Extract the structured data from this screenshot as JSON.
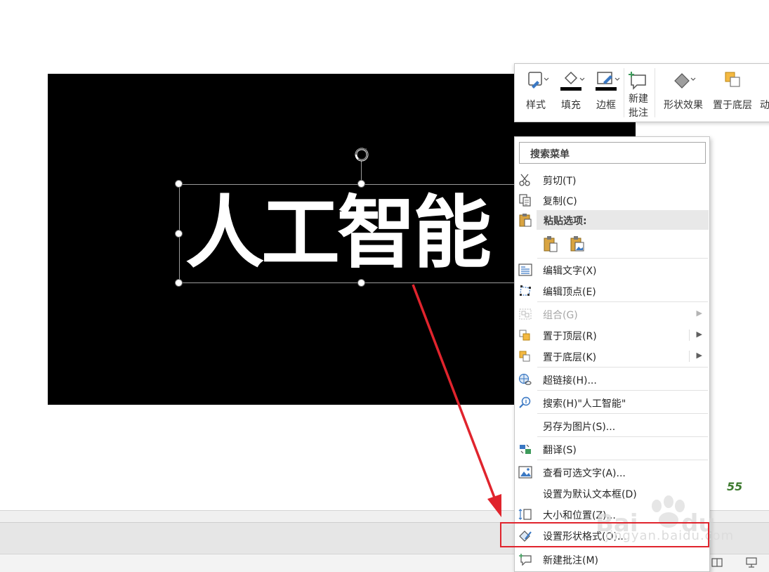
{
  "slide": {
    "text": "人工智能"
  },
  "mini_toolbar": {
    "buttons": [
      {
        "label": "样式",
        "icon": "shape-style-icon"
      },
      {
        "label": "填充",
        "icon": "fill-bucket-icon"
      },
      {
        "label": "边框",
        "icon": "pen-outline-icon"
      },
      {
        "label": "新建\n批注",
        "icon": "new-comment-icon"
      },
      {
        "label": "形状效果",
        "icon": "shape-effects-icon"
      },
      {
        "label": "置于底层",
        "icon": "send-to-back-icon"
      },
      {
        "label": "动",
        "icon": "animation-icon"
      }
    ]
  },
  "context_menu": {
    "search_placeholder": "搜索菜单",
    "cut": "剪切(T)",
    "copy": "复制(C)",
    "paste_options": "粘贴选项:",
    "edit_text": "编辑文字(X)",
    "edit_points": "编辑顶点(E)",
    "group": "组合(G)",
    "bring_to_front": "置于顶层(R)",
    "send_to_back": "置于底层(K)",
    "hyperlink": "超链接(H)...",
    "search": "搜索(H)\"人工智能\"",
    "save_as_picture": "另存为图片(S)...",
    "translate": "翻译(S)",
    "alt_text": "查看可选文字(A)...",
    "set_default_textbox": "设置为默认文本框(D)",
    "size_position": "大小和位置(Z)...",
    "format_shape": "设置形状格式(O)...",
    "new_comment": "新建批注(M)"
  },
  "page_number": "55",
  "watermark": "jingyan.baidu.com",
  "colors": {
    "accent_red": "#e0242d",
    "slide_bg": "#000000",
    "page_num_green": "#3d7a2f"
  }
}
